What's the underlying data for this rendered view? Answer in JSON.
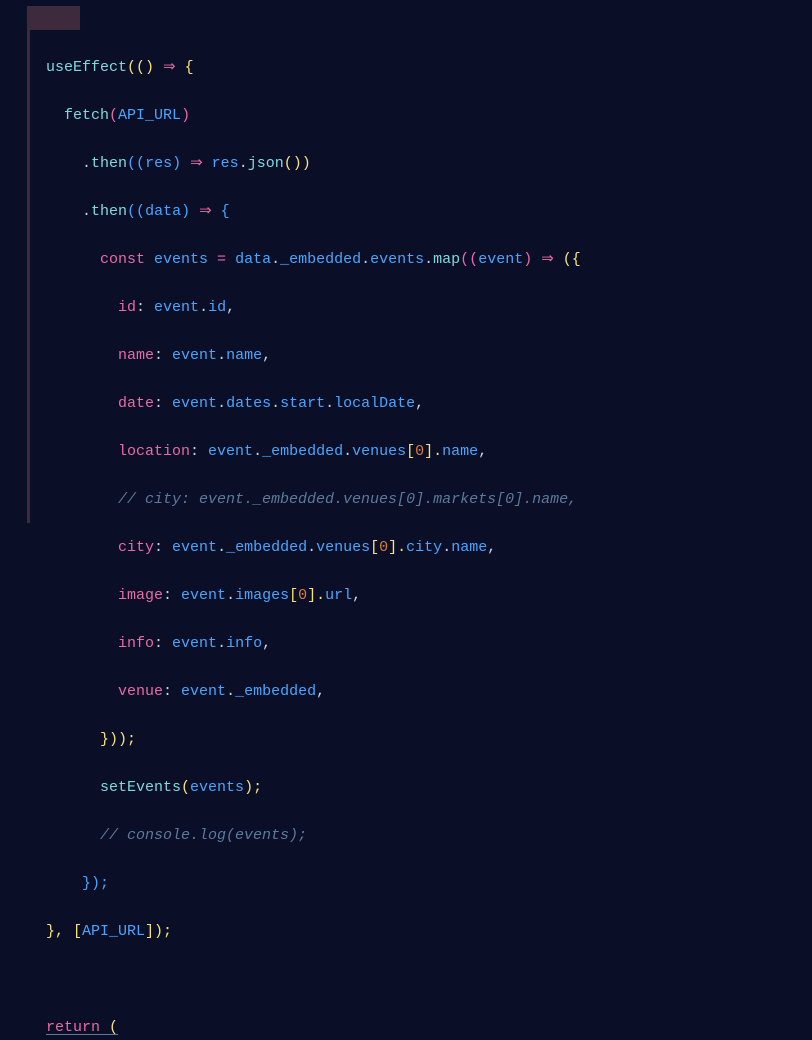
{
  "code": {
    "l1": {
      "a": "useEffect",
      "b": "(()",
      "c": " ⇒ ",
      "d": "{"
    },
    "l2": {
      "a": "fetch",
      "b": "(",
      "c": "API_URL",
      "d": ")"
    },
    "l3": {
      "a": ".",
      "b": "then",
      "c": "((",
      "d": "res",
      "e": ")",
      "f": " ⇒ ",
      "g": "res",
      "h": ".",
      "i": "json",
      "j": "())"
    },
    "l4": {
      "a": ".",
      "b": "then",
      "c": "((",
      "d": "data",
      "e": ")",
      "f": " ⇒ ",
      "g": "{"
    },
    "l5": {
      "a": "const ",
      "b": "events",
      "c": " = ",
      "d": "data",
      "e": ".",
      "f": "_embedded",
      "g": ".",
      "h": "events",
      "i": ".",
      "j": "map",
      "k": "((",
      "l": "event",
      "m": ")",
      "n": " ⇒ ",
      "o": "({"
    },
    "l6": {
      "a": "id",
      "b": ": ",
      "c": "event",
      "d": ".",
      "e": "id",
      "f": ","
    },
    "l7": {
      "a": "name",
      "b": ": ",
      "c": "event",
      "d": ".",
      "e": "name",
      "f": ","
    },
    "l8": {
      "a": "date",
      "b": ": ",
      "c": "event",
      "d": ".",
      "e": "dates",
      "f": ".",
      "g": "start",
      "h": ".",
      "i": "localDate",
      "j": ","
    },
    "l9": {
      "a": "location",
      "b": ": ",
      "c": "event",
      "d": ".",
      "e": "_embedded",
      "f": ".",
      "g": "venues",
      "h": "[",
      "i": "0",
      "j": "].",
      "k": "name",
      "l": ","
    },
    "l10": {
      "a": "// city: event._embedded.venues[0].markets[0].name,"
    },
    "l11": {
      "a": "city",
      "b": ": ",
      "c": "event",
      "d": ".",
      "e": "_embedded",
      "f": ".",
      "g": "venues",
      "h": "[",
      "i": "0",
      "j": "].",
      "k": "city",
      "l": ".",
      "m": "name",
      "n": ","
    },
    "l12": {
      "a": "image",
      "b": ": ",
      "c": "event",
      "d": ".",
      "e": "images",
      "f": "[",
      "g": "0",
      "h": "].",
      "i": "url",
      "j": ","
    },
    "l13": {
      "a": "info",
      "b": ": ",
      "c": "event",
      "d": ".",
      "e": "info",
      "f": ","
    },
    "l14": {
      "a": "venue",
      "b": ": ",
      "c": "event",
      "d": ".",
      "e": "_embedded",
      "f": ","
    },
    "l15": {
      "a": "}));"
    },
    "l16": {
      "a": "setEvents",
      "b": "(",
      "c": "events",
      "d": ");"
    },
    "l17": {
      "a": "// console.log(events);"
    },
    "l18": {
      "a": "});"
    },
    "l19": {
      "a": "}, [",
      "b": "API_URL",
      "c": "]);"
    },
    "l20": "",
    "l21": {
      "a": "return",
      "b": " ("
    }
  }
}
